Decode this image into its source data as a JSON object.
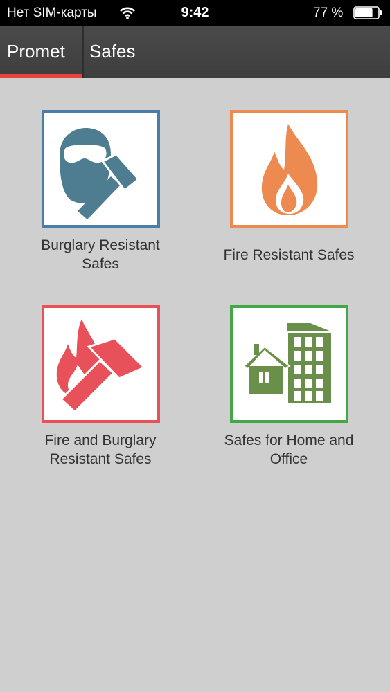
{
  "status_bar": {
    "carrier": "Нет SIM-карты",
    "time": "9:42",
    "battery_percent": "77 %",
    "wifi_icon": "wifi-icon",
    "battery_icon": "battery-icon",
    "battery_level": 0.77
  },
  "tabs": [
    {
      "label": "Promet",
      "selected": true
    },
    {
      "label": "Safes",
      "selected": false
    }
  ],
  "accent_color": "#e8423a",
  "categories": [
    {
      "label": "Burglary Resistant Safes",
      "icon": "burglar-hammer-icon",
      "color": "#4a7ea8"
    },
    {
      "label": "Fire Resistant Safes",
      "icon": "flame-icon",
      "color": "#ec8a4f"
    },
    {
      "label": "Fire and Burglary Resistant Safes",
      "icon": "flame-hammer-icon",
      "color": "#e8505a"
    },
    {
      "label": "Safes for Home and Office",
      "icon": "house-building-icon",
      "color": "#44a647"
    }
  ]
}
